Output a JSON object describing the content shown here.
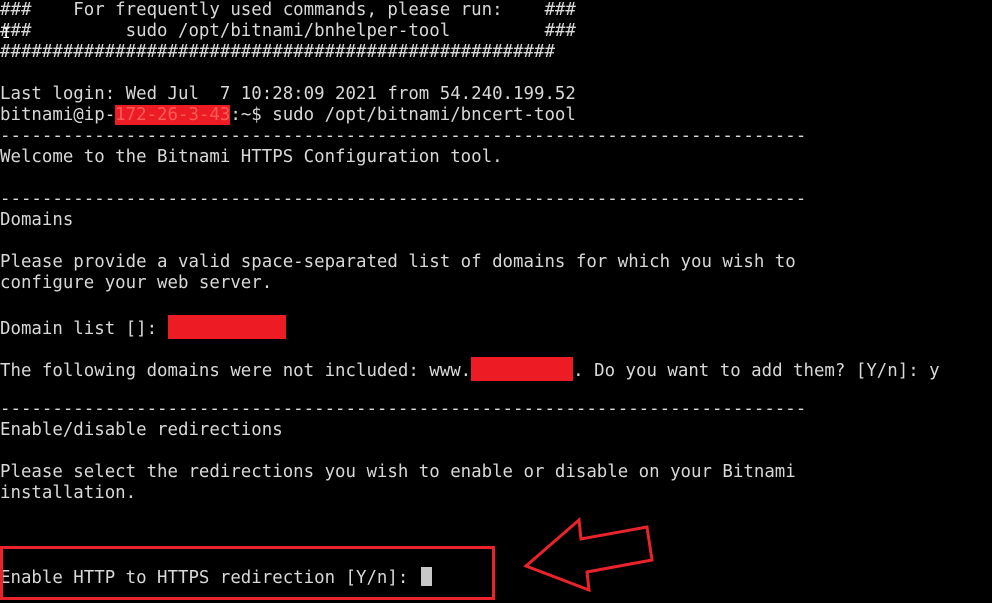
{
  "terminal": {
    "banner_line_1": "###    For frequently used commands, please run:    ###",
    "banner_line_2": "###         sudo /opt/bitnami/bnhelper-tool         ###",
    "banner_line_3": "#####################################################",
    "last_login": "Last login: Wed Jul  7 10:28:09 2021 from 54.240.199.52",
    "prompt_user": "bitnami@ip-",
    "prompt_host_redacted": "172-26-3-43",
    "prompt_suffix": ":~$ sudo /opt/bitnami/bncert-tool",
    "separator": "-----------------------------------------------------------------------------",
    "welcome": "Welcome to the Bitnami HTTPS Configuration tool.",
    "domains_heading": "Domains",
    "domains_prompt_1": "Please provide a valid space-separated list of domains for which you wish to",
    "domains_prompt_2": "configure your web server.",
    "domain_list_label": "Domain list []: ",
    "not_included_prefix": "The following domains were not included: www.",
    "not_included_suffix": ". Do you want to add them? [Y/n]: y",
    "redirections_heading": "Enable/disable redirections",
    "redirections_prompt_1": "Please select the redirections you wish to enable or disable on your Bitnami",
    "redirections_prompt_2": "installation.",
    "http_to_https_prompt": "Enable HTTP to HTTPS redirection [Y/n]: "
  },
  "annotation": {
    "highlight_color": "#e8232b",
    "redaction_color": "#ed1c24"
  }
}
